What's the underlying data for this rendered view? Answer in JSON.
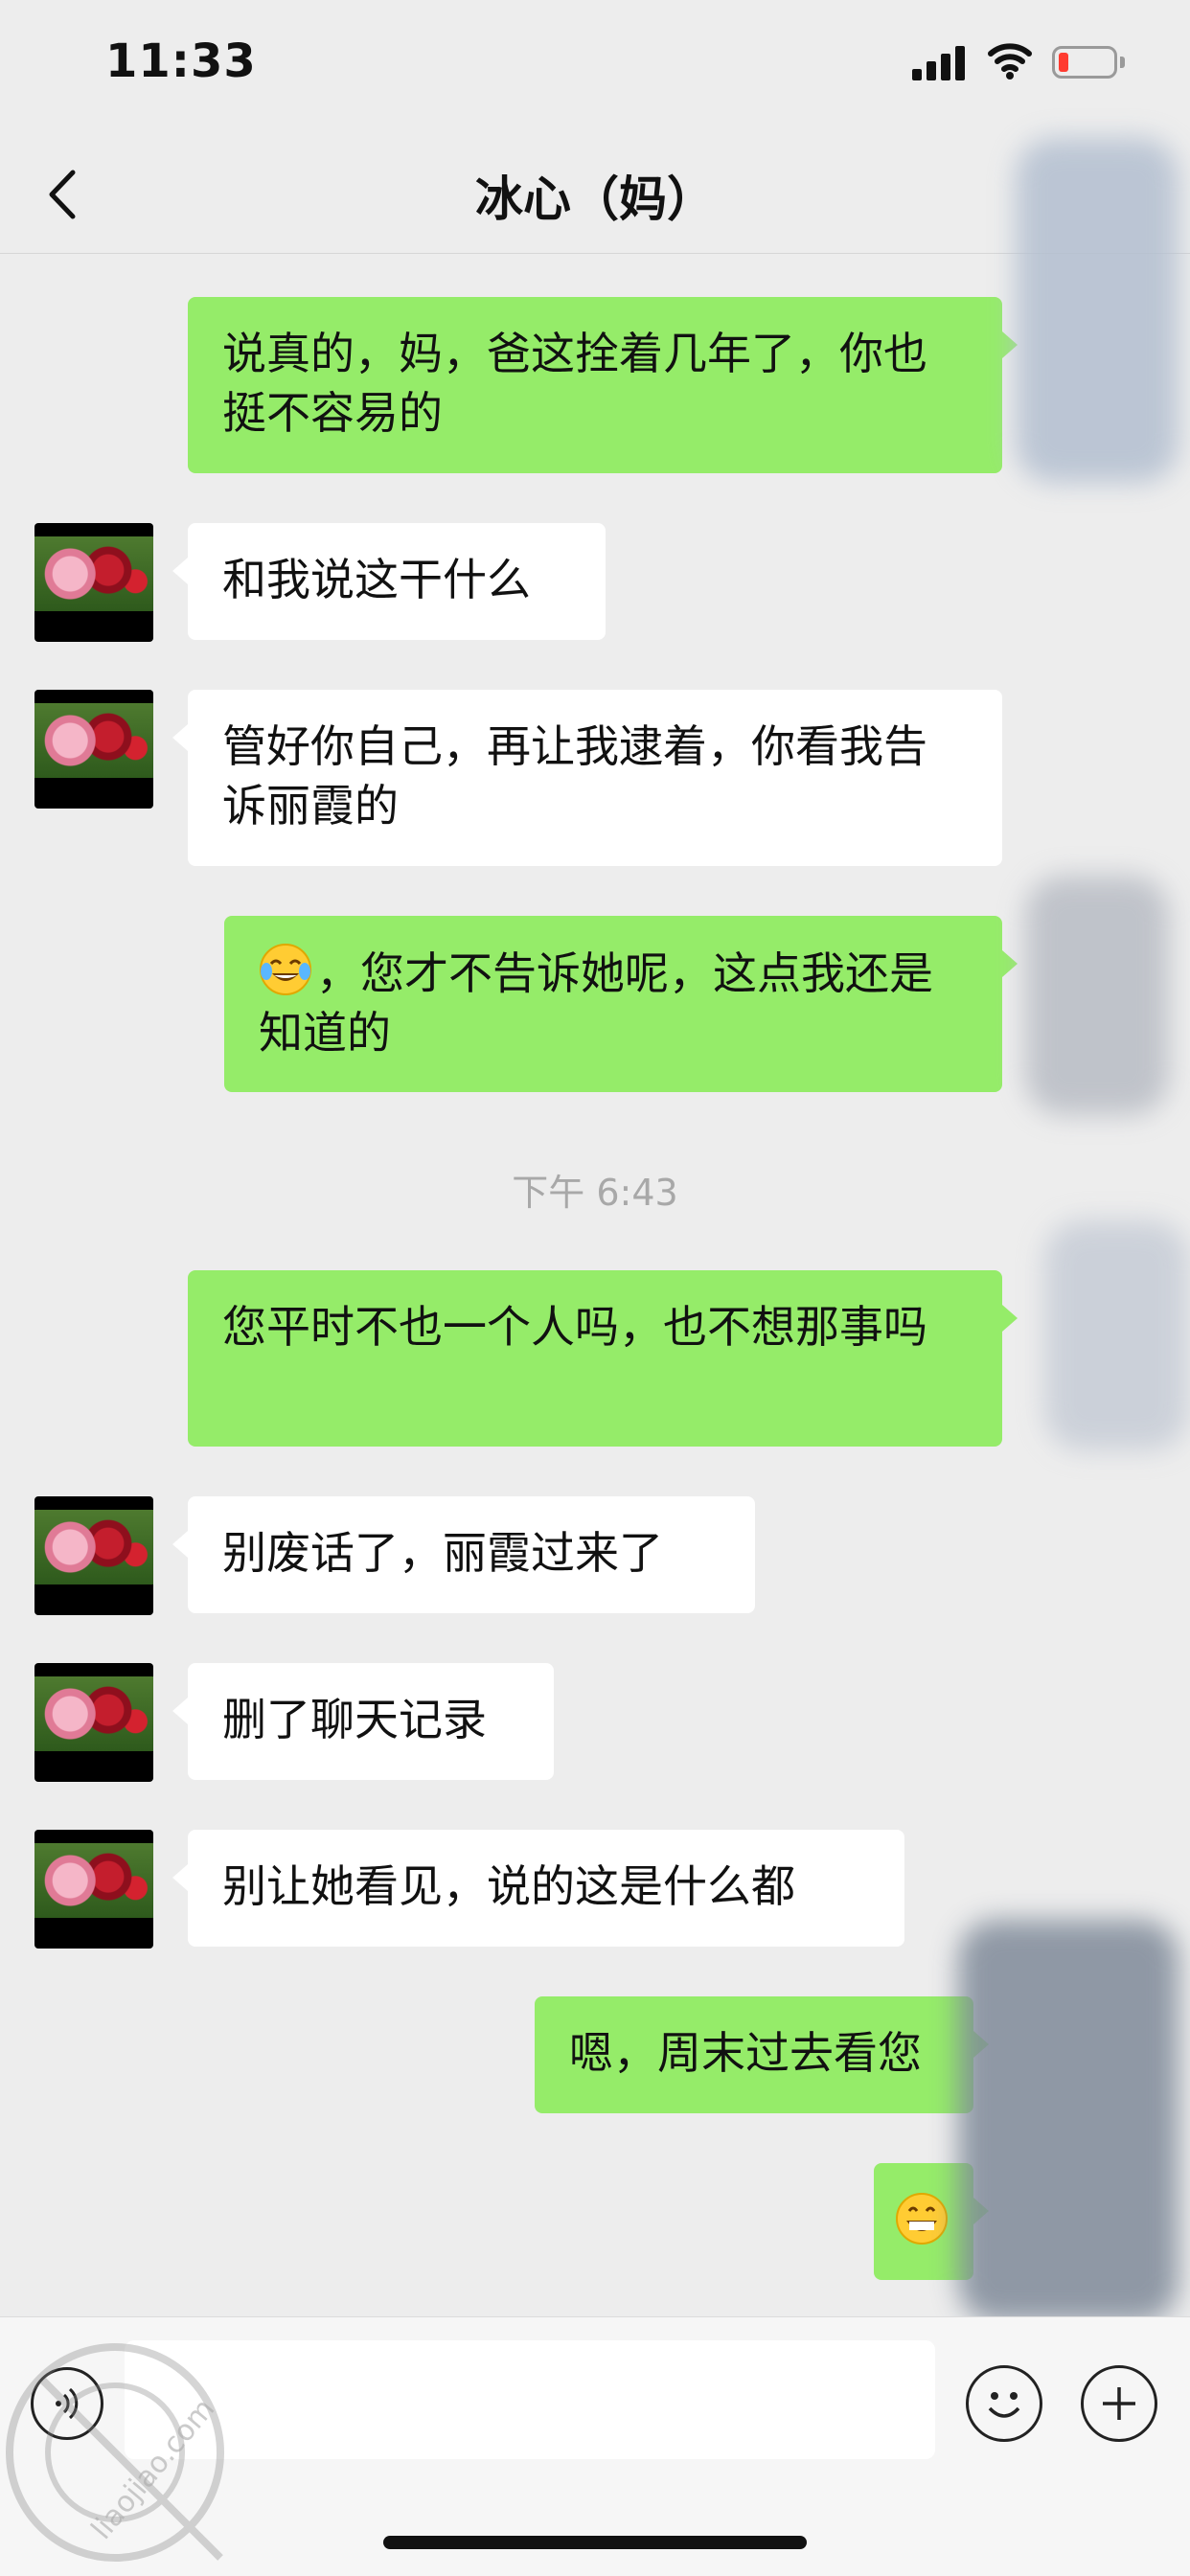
{
  "status_bar": {
    "time": "11:33",
    "battery_color": "#ff3b30"
  },
  "nav": {
    "title": "冰心（妈）",
    "back_icon": "chevron-left-icon"
  },
  "colors": {
    "background": "#ededed",
    "bubble_out": "#95ec69",
    "bubble_in": "#ffffff",
    "timestamp": "#a8a8a8"
  },
  "messages": [
    {
      "side": "out",
      "text": "说真的，妈，爸这拴着几年了，你也挺不容易的"
    },
    {
      "side": "in",
      "text": "和我说这干什么"
    },
    {
      "side": "in",
      "text": "管好你自己，再让我逮着，你看我告诉丽霞的"
    },
    {
      "side": "out",
      "emoji": "tears-of-joy-emoji",
      "text": "，您才不告诉她呢，这点我还是知道的"
    },
    {
      "side": "out",
      "text": "您平时不也一个人吗，也不想那事吗"
    },
    {
      "side": "in",
      "text": "别废话了，丽霞过来了"
    },
    {
      "side": "in",
      "text": "删了聊天记录"
    },
    {
      "side": "in",
      "text": "别让她看见，说的这是什么都"
    },
    {
      "side": "out",
      "text": "嗯，周末过去看您"
    },
    {
      "side": "out",
      "emoji": "grinning-emoji",
      "text": ""
    }
  ],
  "timestamp": "下午 6:43",
  "input_bar": {
    "voice_icon": "voice-icon",
    "input_placeholder": "",
    "emoji_icon": "smiley-icon",
    "plus_icon": "plus-icon"
  },
  "watermark": {
    "text": "liaojiao.com"
  }
}
